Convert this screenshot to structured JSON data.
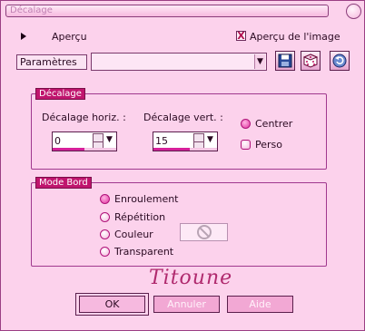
{
  "window": {
    "title": "Décalage"
  },
  "preview": {
    "label": "Aperçu",
    "checkbox_label": "Aperçu de l'image",
    "checkbox_mark": "X",
    "checked": true
  },
  "params": {
    "label": "Paramètres",
    "combo_value": "",
    "combo_arrow": "▼"
  },
  "offset_group": {
    "title": "Décalage",
    "horiz_label": "Décalage horiz. :",
    "vert_label": "Décalage vert. :",
    "horiz_value": "0",
    "vert_value": "15",
    "horiz_fill": 0.5,
    "vert_fill": 0.57,
    "center_label": "Centrer",
    "custom_label": "Perso",
    "selected": "Centrer"
  },
  "edge_group": {
    "title": "Mode Bord",
    "options": [
      "Enroulement",
      "Répétition",
      "Couleur",
      "Transparent"
    ],
    "selected": "Enroulement"
  },
  "signature": "Titoune",
  "buttons": {
    "ok": "OK",
    "cancel": "Annuler",
    "help": "Aide"
  },
  "colors": {
    "background": "#fcd2ec",
    "accent": "#c0156e",
    "border": "#a0388e"
  }
}
